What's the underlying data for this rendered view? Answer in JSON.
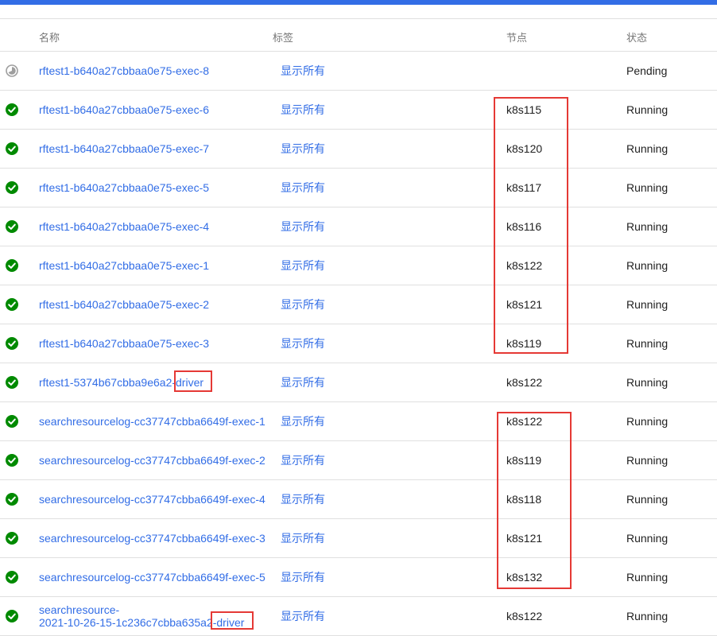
{
  "header": {
    "name": "名称",
    "labels": "标签",
    "node": "节点",
    "status": "状态"
  },
  "colors": {
    "accent": "#326de6",
    "running": "#008a00",
    "pending": "#9e9e9e",
    "highlight": "#e53935"
  },
  "rows": [
    {
      "icon": "pending-icon",
      "name": "rftest1-b640a27cbbaa0e75-exec-8",
      "label": "显示所有",
      "node": "",
      "status": "Pending"
    },
    {
      "icon": "check-circle-icon",
      "name": "rftest1-b640a27cbbaa0e75-exec-6",
      "label": "显示所有",
      "node": "k8s115",
      "status": "Running"
    },
    {
      "icon": "check-circle-icon",
      "name": "rftest1-b640a27cbbaa0e75-exec-7",
      "label": "显示所有",
      "node": "k8s120",
      "status": "Running"
    },
    {
      "icon": "check-circle-icon",
      "name": "rftest1-b640a27cbbaa0e75-exec-5",
      "label": "显示所有",
      "node": "k8s117",
      "status": "Running"
    },
    {
      "icon": "check-circle-icon",
      "name": "rftest1-b640a27cbbaa0e75-exec-4",
      "label": "显示所有",
      "node": "k8s116",
      "status": "Running"
    },
    {
      "icon": "check-circle-icon",
      "name": "rftest1-b640a27cbbaa0e75-exec-1",
      "label": "显示所有",
      "node": "k8s122",
      "status": "Running"
    },
    {
      "icon": "check-circle-icon",
      "name": "rftest1-b640a27cbbaa0e75-exec-2",
      "label": "显示所有",
      "node": "k8s121",
      "status": "Running"
    },
    {
      "icon": "check-circle-icon",
      "name": "rftest1-b640a27cbbaa0e75-exec-3",
      "label": "显示所有",
      "node": "k8s119",
      "status": "Running"
    },
    {
      "icon": "check-circle-icon",
      "name": "rftest1-5374b67cbba9e6a2-driver",
      "label": "显示所有",
      "node": "k8s122",
      "status": "Running"
    },
    {
      "icon": "check-circle-icon",
      "name": "searchresourcelog-cc37747cbba6649f-exec-1",
      "label": "显示所有",
      "node": "k8s122",
      "status": "Running"
    },
    {
      "icon": "check-circle-icon",
      "name": "searchresourcelog-cc37747cbba6649f-exec-2",
      "label": "显示所有",
      "node": "k8s119",
      "status": "Running"
    },
    {
      "icon": "check-circle-icon",
      "name": "searchresourcelog-cc37747cbba6649f-exec-4",
      "label": "显示所有",
      "node": "k8s118",
      "status": "Running"
    },
    {
      "icon": "check-circle-icon",
      "name": "searchresourcelog-cc37747cbba6649f-exec-3",
      "label": "显示所有",
      "node": "k8s121",
      "status": "Running"
    },
    {
      "icon": "check-circle-icon",
      "name": "searchresourcelog-cc37747cbba6649f-exec-5",
      "label": "显示所有",
      "node": "k8s132",
      "status": "Running"
    },
    {
      "icon": "check-circle-icon",
      "name": "searchresource-\n2021-10-26-15-1c236c7cbba635a2-driver",
      "label": "显示所有",
      "node": "k8s122",
      "status": "Running"
    }
  ]
}
